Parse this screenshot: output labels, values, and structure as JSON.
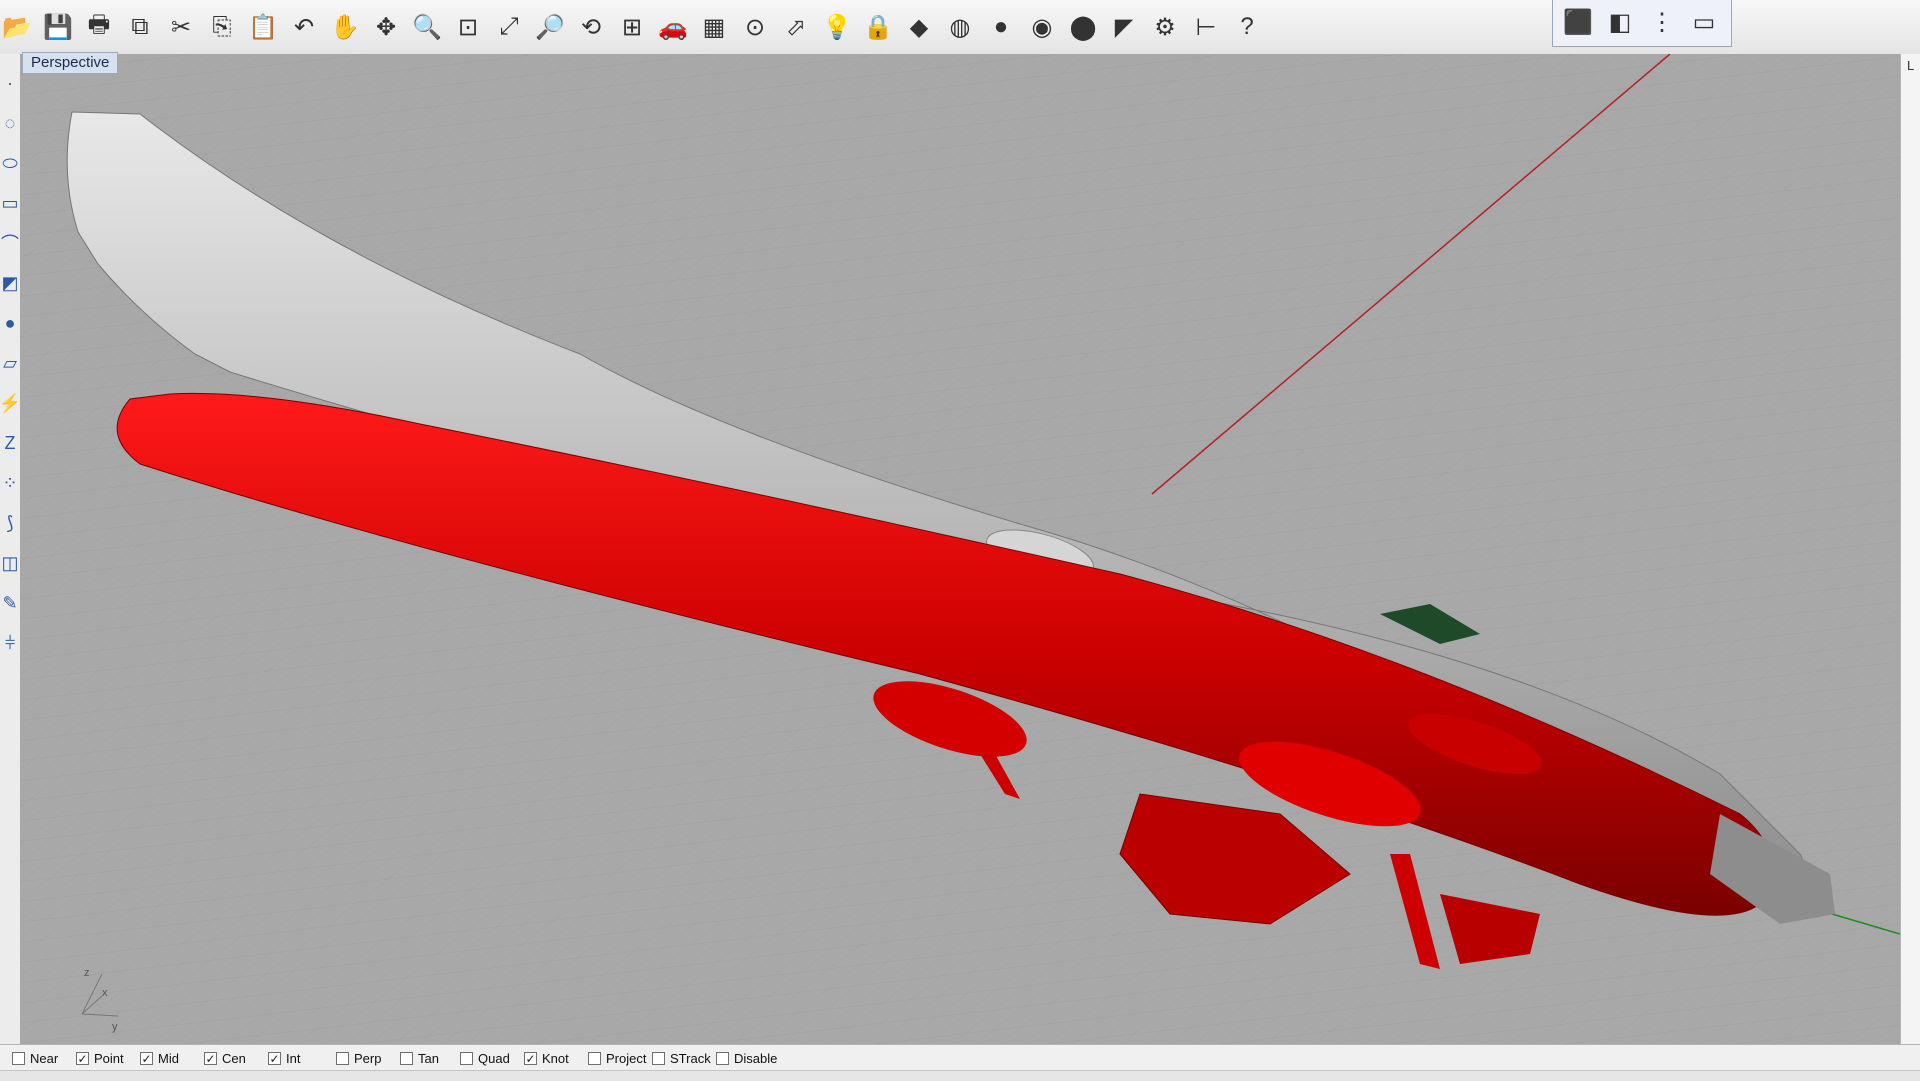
{
  "viewport": {
    "title": "Perspective",
    "axis_labels": {
      "z": "z",
      "x": "x",
      "y": "y"
    }
  },
  "toolbar": {
    "buttons": [
      {
        "name": "open-icon",
        "glyph": "📂"
      },
      {
        "name": "save-icon",
        "glyph": "💾"
      },
      {
        "name": "print-icon",
        "glyph": "🖶"
      },
      {
        "name": "copy-window-icon",
        "glyph": "⧉"
      },
      {
        "name": "cut-icon",
        "glyph": "✂"
      },
      {
        "name": "copy-icon",
        "glyph": "⎘"
      },
      {
        "name": "paste-icon",
        "glyph": "📋"
      },
      {
        "name": "undo-icon",
        "glyph": "↶"
      },
      {
        "name": "pan-icon",
        "glyph": "✋"
      },
      {
        "name": "rotate-view-icon",
        "glyph": "✥"
      },
      {
        "name": "zoom-icon",
        "glyph": "🔍"
      },
      {
        "name": "zoom-window-icon",
        "glyph": "⊡"
      },
      {
        "name": "zoom-extents-icon",
        "glyph": "⤢"
      },
      {
        "name": "zoom-selected-icon",
        "glyph": "🔎"
      },
      {
        "name": "undo-view-icon",
        "glyph": "⟲"
      },
      {
        "name": "four-viewports-icon",
        "glyph": "⊞"
      },
      {
        "name": "named-view-icon",
        "glyph": "🚗"
      },
      {
        "name": "grid-icon",
        "glyph": "▦"
      },
      {
        "name": "object-snap-icon",
        "glyph": "⊙"
      },
      {
        "name": "select-icon",
        "glyph": "⬀"
      },
      {
        "name": "light-icon",
        "glyph": "💡"
      },
      {
        "name": "lock-icon",
        "glyph": "🔒"
      },
      {
        "name": "layer-icon",
        "glyph": "◆"
      },
      {
        "name": "color-wheel-icon",
        "glyph": "◍"
      },
      {
        "name": "shaded-sphere-icon",
        "glyph": "●"
      },
      {
        "name": "rendered-sphere-icon",
        "glyph": "◉"
      },
      {
        "name": "render-icon",
        "glyph": "⬤"
      },
      {
        "name": "properties-icon",
        "glyph": "◤"
      },
      {
        "name": "options-icon",
        "glyph": "⚙"
      },
      {
        "name": "dimension-icon",
        "glyph": "⊢"
      },
      {
        "name": "help-icon",
        "glyph": "?"
      }
    ],
    "view_buttons": [
      {
        "name": "perspective-view-icon",
        "glyph": "⬛"
      },
      {
        "name": "top-view-icon",
        "glyph": "◧"
      },
      {
        "name": "front-view-icon",
        "glyph": "⋮"
      },
      {
        "name": "right-view-icon",
        "glyph": "▭"
      }
    ]
  },
  "left_toolbar": {
    "tools": [
      {
        "name": "point-tool-icon",
        "glyph": "·"
      },
      {
        "name": "curve-tool-icon",
        "glyph": "◌"
      },
      {
        "name": "ellipse-tool-icon",
        "glyph": "⬭"
      },
      {
        "name": "rectangle-tool-icon",
        "glyph": "▭"
      },
      {
        "name": "fillet-tool-icon",
        "glyph": "⌒"
      },
      {
        "name": "surface-tool-icon",
        "glyph": "◩"
      },
      {
        "name": "solid-tool-icon",
        "glyph": "●"
      },
      {
        "name": "mesh-tool-icon",
        "glyph": "▱"
      },
      {
        "name": "split-tool-icon",
        "glyph": "⚡"
      },
      {
        "name": "transform-tool-icon",
        "glyph": "Z"
      },
      {
        "name": "points-on-tool-icon",
        "glyph": "⁘"
      },
      {
        "name": "array-tool-icon",
        "glyph": "⟆"
      },
      {
        "name": "analyze-tool-icon",
        "glyph": "◫"
      },
      {
        "name": "dimension-tool-icon",
        "glyph": "✎"
      },
      {
        "name": "render-tool-icon",
        "glyph": "⫩"
      }
    ]
  },
  "osnap": {
    "items": [
      {
        "label": "Near",
        "checked": false
      },
      {
        "label": "Point",
        "checked": true
      },
      {
        "label": "Mid",
        "checked": true
      },
      {
        "label": "Cen",
        "checked": true
      },
      {
        "label": "Int",
        "checked": true
      },
      {
        "label": "Perp",
        "checked": false
      },
      {
        "label": "Tan",
        "checked": false
      },
      {
        "label": "Quad",
        "checked": false
      },
      {
        "label": "Knot",
        "checked": true
      },
      {
        "label": "Project",
        "checked": false
      },
      {
        "label": "STrack",
        "checked": false
      },
      {
        "label": "Disable",
        "checked": false
      }
    ]
  },
  "right_panel": {
    "label": "L"
  },
  "colors": {
    "viewport_bg": "#a8a8a8",
    "hull_red": "#d80000",
    "hull_grey": "#bdbdbd",
    "x_axis": "#b22222",
    "y_axis": "#1c8c1c",
    "green_part": "#1f4a2a"
  }
}
